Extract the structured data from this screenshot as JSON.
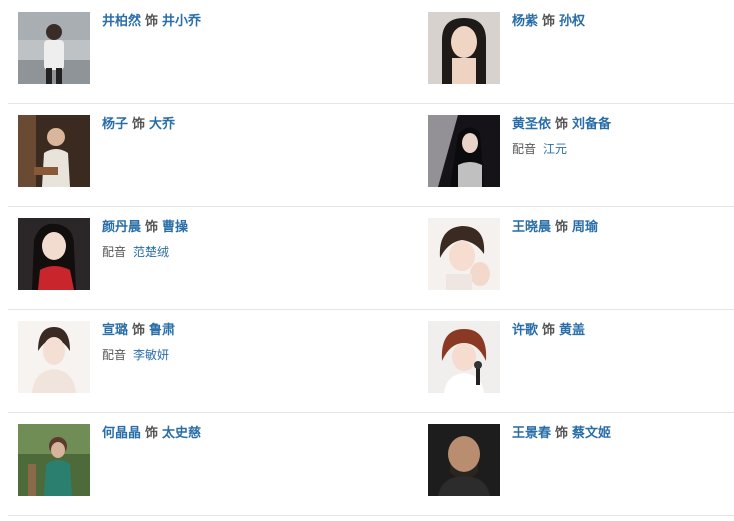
{
  "cast": [
    {
      "left": {
        "actor": "井柏然",
        "as": "饰",
        "character": "井小乔",
        "voice_label": "",
        "voice_actor": "",
        "photo": "actor-photo-street-casual"
      },
      "right": {
        "actor": "杨紫",
        "as": "饰",
        "character": "孙权",
        "voice_label": "",
        "voice_actor": "",
        "photo": "actor-photo-long-hair"
      }
    },
    {
      "left": {
        "actor": "杨子",
        "as": "饰",
        "character": "大乔",
        "voice_label": "",
        "voice_actor": "",
        "photo": "actor-photo-seated"
      },
      "right": {
        "actor": "黄圣依",
        "as": "饰",
        "character": "刘备备",
        "voice_label": "配音",
        "voice_actor": "江元",
        "photo": "actor-photo-dark-studio"
      }
    },
    {
      "left": {
        "actor": "颜丹晨",
        "as": "饰",
        "character": "曹操",
        "voice_label": "配音",
        "voice_actor": "范楚绒",
        "photo": "actor-photo-red-dress"
      },
      "right": {
        "actor": "王晓晨",
        "as": "饰",
        "character": "周瑜",
        "voice_label": "",
        "voice_actor": "",
        "photo": "actor-photo-smiling"
      }
    },
    {
      "left": {
        "actor": "宣璐",
        "as": "饰",
        "character": "鲁肃",
        "voice_label": "配音",
        "voice_actor": "李敏妍",
        "photo": "actor-photo-white-portrait"
      },
      "right": {
        "actor": "许歌",
        "as": "饰",
        "character": "黄盖",
        "voice_label": "",
        "voice_actor": "",
        "photo": "actor-photo-microphone"
      }
    },
    {
      "left": {
        "actor": "何晶晶",
        "as": "饰",
        "character": "太史慈",
        "voice_label": "",
        "voice_actor": "",
        "photo": "actor-photo-outdoor"
      },
      "right": {
        "actor": "王景春",
        "as": "饰",
        "character": "蔡文姬",
        "voice_label": "",
        "voice_actor": "",
        "photo": "actor-photo-dark-portrait"
      }
    }
  ],
  "colors": {
    "link": "#2a6ea8",
    "muted": "#555555",
    "divider": "#e5e5e5"
  }
}
